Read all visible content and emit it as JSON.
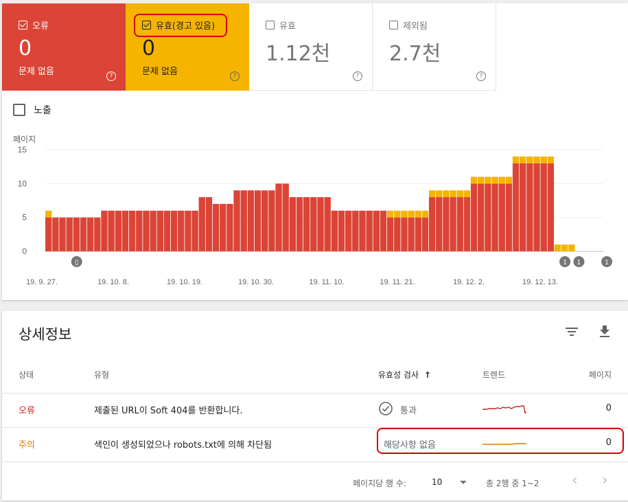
{
  "summary": {
    "error": {
      "label": "오류",
      "value": "0",
      "sub": "문제 없음",
      "help": "?"
    },
    "warning": {
      "label": "유효(경고 있음)",
      "value": "0",
      "sub": "문제 없음",
      "help": "?"
    },
    "valid": {
      "label": "유효",
      "value": "1.12천",
      "help": "?"
    },
    "excluded": {
      "label": "제외됨",
      "value": "2.7천",
      "help": "?"
    }
  },
  "impressions_label": "노출",
  "colors": {
    "error": "#db4437",
    "warning": "#f4b400",
    "highlight": "#d50000"
  },
  "chart_data": {
    "type": "bar",
    "ylabel": "페이지",
    "ylim": [
      0,
      15
    ],
    "yticks": [
      0,
      5,
      10,
      15
    ],
    "xtick_labels": [
      "19. 9. 27.",
      "19. 10. 8.",
      "19. 10. 19.",
      "19. 10. 30.",
      "19. 11. 10.",
      "19. 11. 21.",
      "19. 12. 2.",
      "19. 12. 13."
    ],
    "series": [
      {
        "name": "오류",
        "color": "#db4437",
        "values": [
          5,
          5,
          5,
          5,
          5,
          5,
          5,
          5,
          6,
          6,
          6,
          6,
          6,
          6,
          6,
          6,
          6,
          6,
          6,
          6,
          6,
          6,
          8,
          8,
          7,
          7,
          7,
          9,
          9,
          9,
          9,
          9,
          9,
          10,
          10,
          8,
          8,
          8,
          8,
          8,
          8,
          6,
          6,
          6,
          6,
          6,
          6,
          6,
          6,
          5,
          5,
          5,
          5,
          5,
          5,
          8,
          8,
          8,
          8,
          8,
          8,
          10,
          10,
          10,
          10,
          10,
          10,
          13,
          13,
          13,
          13,
          13,
          13,
          0,
          0,
          0,
          0,
          0,
          0,
          0
        ]
      },
      {
        "name": "경고",
        "color": "#f4b400",
        "values": [
          1,
          0,
          0,
          0,
          0,
          0,
          0,
          0,
          0,
          0,
          0,
          0,
          0,
          0,
          0,
          0,
          0,
          0,
          0,
          0,
          0,
          0,
          0,
          0,
          0,
          0,
          0,
          0,
          0,
          0,
          0,
          0,
          0,
          0,
          0,
          0,
          0,
          0,
          0,
          0,
          0,
          0,
          0,
          0,
          0,
          0,
          0,
          0,
          0,
          1,
          1,
          1,
          1,
          1,
          1,
          1,
          1,
          1,
          1,
          1,
          1,
          1,
          1,
          1,
          1,
          1,
          1,
          1,
          1,
          1,
          1,
          1,
          1,
          1,
          1,
          1,
          0,
          0,
          0,
          0
        ]
      }
    ],
    "annotations": [
      {
        "label": "▯",
        "index": 4
      },
      {
        "label": "1",
        "index": 74
      },
      {
        "label": "1",
        "index": 76
      },
      {
        "label": "1",
        "index": 80
      }
    ]
  },
  "details": {
    "title": "상세정보",
    "filter_icon": "filter-icon",
    "download_icon": "download-icon",
    "columns": {
      "status": "상태",
      "type": "유형",
      "validation": "유효성 검사",
      "sort": "↑",
      "trend": "트렌드",
      "pages": "페이지"
    },
    "rows": [
      {
        "status": "오류",
        "status_color": "#c5221f",
        "type": "제출된 URL이 Soft 404를 반환합니다.",
        "validation": "통과",
        "pages": "0"
      },
      {
        "status": "주의",
        "status_color": "#e37400",
        "type": "색인이 생성되었으나 robots.txt에 의해 차단됨",
        "validation": "해당사항 없음",
        "pages": "0"
      }
    ],
    "footer": {
      "rows_per_page_label": "페이지당 행 수:",
      "rows_per_page": "10",
      "range": "총 2행 중 1~2",
      "prev": "‹",
      "next": "›"
    }
  }
}
